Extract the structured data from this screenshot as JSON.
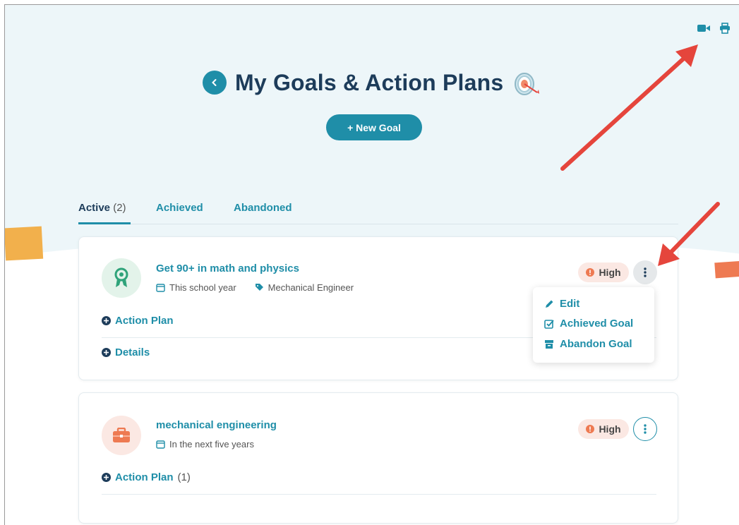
{
  "header": {
    "title": "My Goals & Action Plans",
    "new_goal_label": "+ New Goal",
    "icons": [
      "video-icon",
      "print-icon"
    ]
  },
  "tabs": [
    {
      "label": "Active",
      "count": "(2)",
      "active": true
    },
    {
      "label": "Achieved",
      "count": "",
      "active": false
    },
    {
      "label": "Abandoned",
      "count": "",
      "active": false
    }
  ],
  "goals": [
    {
      "title": "Get 90+ in math and physics",
      "timeframe": "This school year",
      "tag": "Mechanical Engineer",
      "priority": "High",
      "action_plan_label": "Action Plan",
      "details_label": "Details",
      "icon": "ribbon-award-icon"
    },
    {
      "title": "mechanical engineering",
      "timeframe": "In the next five years",
      "priority": "High",
      "action_plan_label": "Action Plan",
      "action_plan_count": "(1)",
      "icon": "briefcase-icon"
    }
  ],
  "menu": {
    "edit": "Edit",
    "achieved": "Achieved Goal",
    "abandon": "Abandon Goal"
  },
  "colors": {
    "accent": "#1f8ea8",
    "title": "#1d3c5a",
    "hero_bg": "#edf6f9",
    "priority_bg": "#fbe8e3",
    "priority_icon": "#ee7a52",
    "annotation_arrow": "#e5453c"
  }
}
